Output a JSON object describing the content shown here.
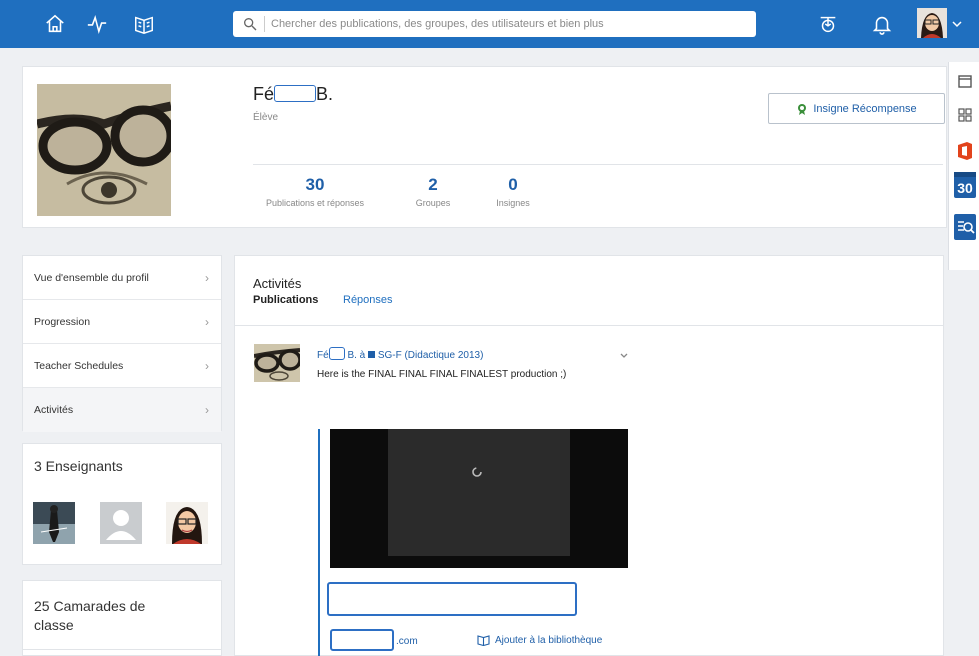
{
  "topbar": {
    "search_placeholder": "Chercher des publications, des groupes, des utilisateurs et bien plus"
  },
  "profile": {
    "name_first": "Fé",
    "name_last": "B.",
    "role": "Élève",
    "award_button": "Insigne Récompense",
    "stats": [
      {
        "value": "30",
        "label": "Publications et réponses"
      },
      {
        "value": "2",
        "label": "Groupes"
      },
      {
        "value": "0",
        "label": "Insignes"
      }
    ]
  },
  "sidebar": {
    "items": [
      {
        "label": "Vue d'ensemble du profil"
      },
      {
        "label": "Progression"
      },
      {
        "label": "Teacher Schedules"
      },
      {
        "label": "Activités"
      }
    ],
    "teachers_title": "3 Enseignants",
    "classmates_title": "25 Camarades de classe"
  },
  "dock": {
    "calendar_day": "30"
  },
  "activities": {
    "title": "Activités",
    "tab_publications": "Publications",
    "tab_replies": "Réponses",
    "post": {
      "author_first": "Fé",
      "author_last": "B. à",
      "group": "SG-F (Didactique 2013)",
      "text": "Here is the FINAL FINAL FINAL FINALEST production ;)",
      "url_suffix": ".com",
      "add_library": "Ajouter à la bibliothèque"
    }
  }
}
